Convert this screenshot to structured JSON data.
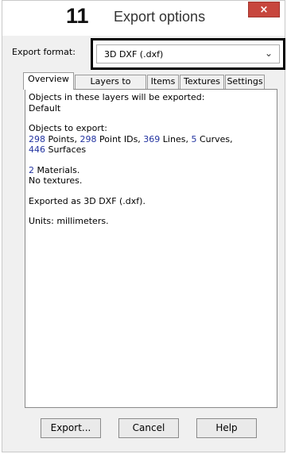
{
  "window": {
    "step_number": "11",
    "title": "Export options",
    "close_glyph": "×"
  },
  "format": {
    "label": "Export format:",
    "value": "3D DXF (.dxf)",
    "chevron_glyph": "⌄"
  },
  "tabs": [
    {
      "label": "Overview",
      "active": true
    },
    {
      "label": "Layers to export",
      "active": false
    },
    {
      "label": "Items",
      "active": false
    },
    {
      "label": "Textures",
      "active": false
    },
    {
      "label": "Settings",
      "active": false
    }
  ],
  "overview": {
    "layers_heading": "Objects in these layers will be exported:",
    "layers_value": "Default",
    "objects_heading": "Objects to export:",
    "counts": {
      "points": "298",
      "points_label": " Points, ",
      "point_ids": "298",
      "point_ids_label": " Point IDs, ",
      "lines": "369",
      "lines_label": " Lines, ",
      "curves": "5",
      "curves_label": " Curves,",
      "surfaces": "446",
      "surfaces_label": " Surfaces"
    },
    "materials_count": "2",
    "materials_label": " Materials.",
    "textures_line": "No textures.",
    "exported_as": "Exported as 3D DXF (.dxf).",
    "units": "Units: millimeters."
  },
  "buttons": {
    "export": "Export...",
    "cancel": "Cancel",
    "help": "Help"
  },
  "colors": {
    "close_button": "#c7463d",
    "number_highlight": "#2233a0"
  }
}
